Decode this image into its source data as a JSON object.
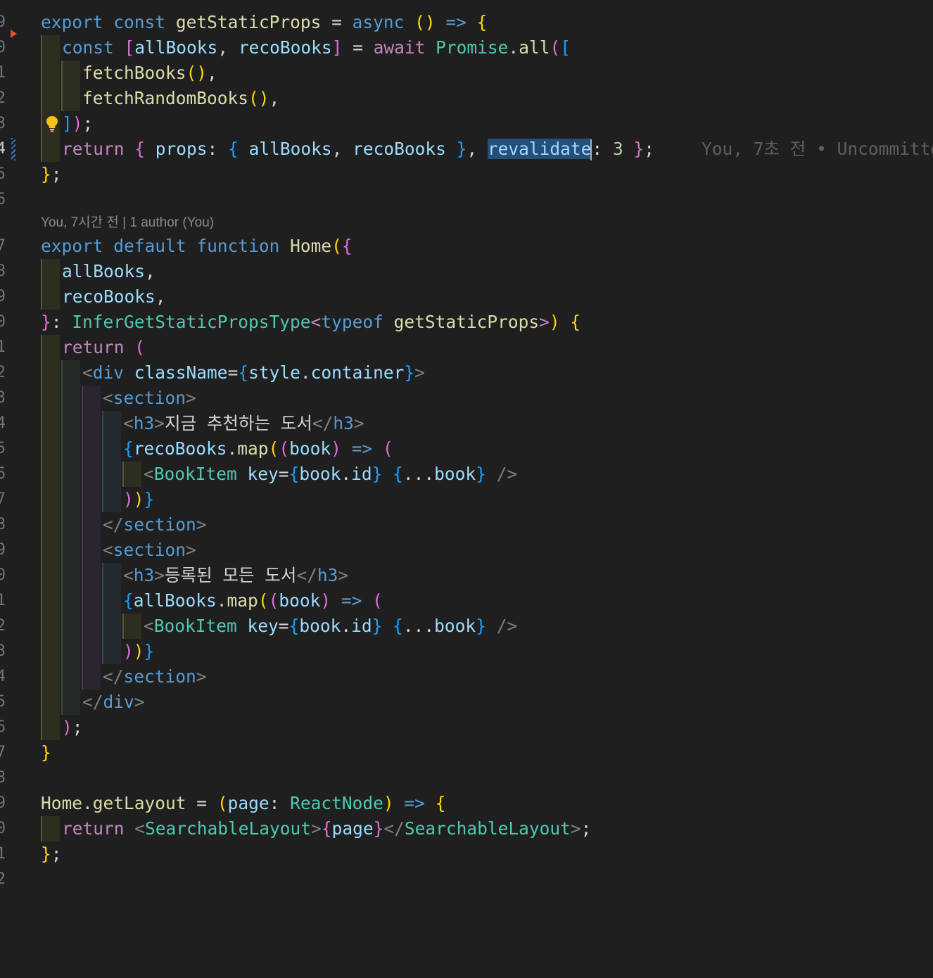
{
  "editor": {
    "line_numbers": [
      "9",
      "0",
      "1",
      "2",
      "3",
      "4",
      "5",
      "6",
      "",
      "7",
      "8",
      "9",
      "0",
      "1",
      "2",
      "3",
      "4",
      "5",
      "6",
      "7",
      "8",
      "9",
      "0",
      "1",
      "2",
      "3",
      "4",
      "5",
      "6",
      "7",
      "8",
      "9",
      "0",
      "1",
      "2"
    ],
    "blame_inline": "You, 7초 전 • Uncommitte",
    "codelens": "You, 7시간 전 | 1 author (You)",
    "lines": {
      "l1": {
        "export": "export",
        "const": "const",
        "name": "getStaticProps",
        "eq": " = ",
        "async": "async",
        "paren": "()",
        "arrow": " => ",
        "brace": "{"
      },
      "l2": {
        "const": "const",
        "open": "[",
        "a": "allBooks",
        "comma": ", ",
        "b": "recoBooks",
        "close": "]",
        "eq": " = ",
        "await": "await",
        "promise": "Promise",
        "dot": ".",
        "all": "all",
        "p": "(",
        "arr": "["
      },
      "l3": {
        "fn": "fetchBooks",
        "call": "()",
        "comma": ","
      },
      "l4": {
        "fn": "fetchRandomBooks",
        "call": "()",
        "comma": ","
      },
      "l5": {
        "arr": "]",
        "p": ")",
        "semi": ";"
      },
      "l6": {
        "ret": "return",
        "ob": " { ",
        "props": "props",
        "colon": ": ",
        "ib": "{ ",
        "a": "allBooks",
        "comma": ", ",
        "b": "recoBooks",
        "ic": " }",
        "comma2": ", ",
        "rev": "revalidate",
        "colon2": ": ",
        "num": "3",
        "oc": " }",
        "semi": ";"
      },
      "l7": {
        "close": "}",
        "semi": ";"
      },
      "l8": {
        "export": "export",
        "default": "default",
        "function": "function",
        "name": "Home",
        "p": "(",
        "b": "{"
      },
      "l9": {
        "v": "allBooks",
        "comma": ","
      },
      "l10": {
        "v": "recoBooks",
        "comma": ","
      },
      "l11": {
        "b": "}",
        "colon": ": ",
        "type": "InferGetStaticPropsType",
        "lt": "<",
        "typeof": "typeof",
        "name": "getStaticProps",
        "gt": ">",
        "p": ")",
        "ob": " {"
      },
      "l12": {
        "ret": "return",
        "p": " ("
      },
      "l13": {
        "lt": "<",
        "tag": "div",
        "attr": "className",
        "eq": "=",
        "ob": "{",
        "style": "style",
        "dot": ".",
        "container": "container",
        "cb": "}",
        "gt": ">"
      },
      "l14": {
        "lt": "<",
        "tag": "section",
        "gt": ">"
      },
      "l15": {
        "lt": "<",
        "tag": "h3",
        "gt": ">",
        "text": "지금 추천하는 도서",
        "lt2": "</",
        "tag2": "h3",
        "gt2": ">"
      },
      "l16": {
        "ob": "{",
        "obj": "recoBooks",
        "dot": ".",
        "fn": "map",
        "p": "(",
        "p2": "(",
        "arg": "book",
        "p3": ")",
        "arrow": " => ",
        "p4": "("
      },
      "l17": {
        "lt": "<",
        "comp": "BookItem",
        "attr": " key",
        "eq": "=",
        "ob": "{",
        "obj": "book",
        "dot": ".",
        "id": "id",
        "cb": "}",
        "ob2": " {",
        "spread": "...",
        "obj2": "book",
        "cb2": "}",
        "close": " />"
      },
      "l18": {
        "p": ")",
        "p2": ")",
        "cb": "}"
      },
      "l19": {
        "lt": "</",
        "tag": "section",
        "gt": ">"
      },
      "l20": {
        "lt": "<",
        "tag": "section",
        "gt": ">"
      },
      "l21": {
        "lt": "<",
        "tag": "h3",
        "gt": ">",
        "text": "등록된 모든 도서",
        "lt2": "</",
        "tag2": "h3",
        "gt2": ">"
      },
      "l22": {
        "ob": "{",
        "obj": "allBooks",
        "dot": ".",
        "fn": "map",
        "p": "(",
        "p2": "(",
        "arg": "book",
        "p3": ")",
        "arrow": " => ",
        "p4": "("
      },
      "l23": {
        "lt": "<",
        "comp": "BookItem",
        "attr": " key",
        "eq": "=",
        "ob": "{",
        "obj": "book",
        "dot": ".",
        "id": "id",
        "cb": "}",
        "ob2": " {",
        "spread": "...",
        "obj2": "book",
        "cb2": "}",
        "close": " />"
      },
      "l24": {
        "p": ")",
        "p2": ")",
        "cb": "}"
      },
      "l25": {
        "lt": "</",
        "tag": "section",
        "gt": ">"
      },
      "l26": {
        "lt": "</",
        "tag": "div",
        "gt": ">"
      },
      "l27": {
        "p": ")",
        "semi": ";"
      },
      "l28": {
        "b": "}"
      },
      "l29": {
        "home": "Home",
        "dot": ".",
        "prop": "getLayout",
        "eq": " = ",
        "p": "(",
        "arg": "page",
        "colon": ": ",
        "type": "ReactNode",
        "p2": ")",
        "arrow": " => ",
        "ob": "{"
      },
      "l30": {
        "ret": "return",
        "lt": " <",
        "comp": "SearchableLayout",
        "gt": ">",
        "ob": "{",
        "page": "page",
        "cb": "}",
        "lt2": "</",
        "comp2": "SearchableLayout",
        "gt2": ">",
        "semi": ";"
      },
      "l31": {
        "b": "}",
        "semi": ";"
      }
    }
  }
}
